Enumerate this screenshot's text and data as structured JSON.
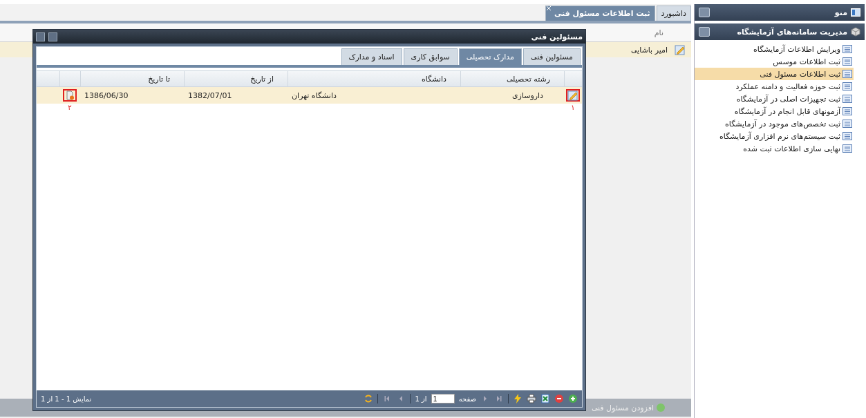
{
  "sidebar": {
    "title": "منو",
    "section": {
      "title": "مدیریت سامانه‌های آزمایشگاه",
      "expanded": true
    },
    "items": [
      {
        "label": "ویرایش اطلاعات آزمایشگاه",
        "selected": false
      },
      {
        "label": "ثبت اطلاعات موسس",
        "selected": false
      },
      {
        "label": "ثبت اطلاعات مسئول فنی",
        "selected": true
      },
      {
        "label": "ثبت حوزه فعالیت و دامنه عملکرد",
        "selected": false
      },
      {
        "label": "ثبت تجهیزات اصلی در آزمایشگاه",
        "selected": false
      },
      {
        "label": "آزمونهای قابل انجام در آزمایشگاه",
        "selected": false
      },
      {
        "label": "ثبت تخصص‌های موجود در آزمایشگاه",
        "selected": false
      },
      {
        "label": "ثبت سیستم‌های نرم افزاری آزمایشگاه",
        "selected": false
      },
      {
        "label": "نهایی سازی اطلاعات ثبت شده",
        "selected": false
      }
    ]
  },
  "tabs": [
    {
      "label": "داشبورد",
      "selected": false,
      "closable": false
    },
    {
      "label": "ثبت اطلاعات مسئول فنی",
      "selected": true,
      "closable": true
    }
  ],
  "background_grid": {
    "columns": [
      "نام"
    ],
    "rows": [
      {
        "name": "امیر باشایی",
        "selected": true
      }
    ],
    "add_button": "افزودن مسئول فنی"
  },
  "dialog": {
    "title": "مسئولین فنی",
    "tabs": [
      {
        "label": "مسئولین فنی",
        "selected": false
      },
      {
        "label": "مدارک تحصیلی",
        "selected": true
      },
      {
        "label": "سوابق کاری",
        "selected": false
      },
      {
        "label": "اسناد و مدارک",
        "selected": false
      }
    ],
    "columns": [
      "رشته تحصیلی",
      "دانشگاه",
      "از تاریخ",
      "تا تاریخ"
    ],
    "rows": [
      {
        "cells": [
          "داروسازی",
          "دانشگاه تهران",
          "1382/07/01",
          "1386/06/30"
        ],
        "selected": true
      }
    ],
    "annotations": [
      "۱",
      "۲"
    ],
    "pager": {
      "page_label": "صفحه",
      "page": "1",
      "of": "از 1",
      "display": "نمایش 1 - 1 از 1"
    }
  }
}
